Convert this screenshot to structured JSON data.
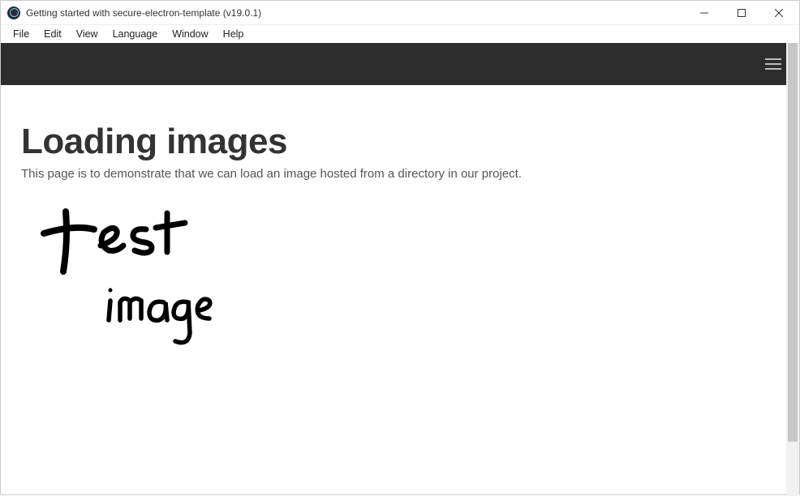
{
  "titlebar": {
    "title": "Getting started with secure-electron-template (v19.0.1)"
  },
  "menubar": {
    "items": [
      "File",
      "Edit",
      "View",
      "Language",
      "Window",
      "Help"
    ]
  },
  "page": {
    "heading": "Loading images",
    "description": "This page is to demonstrate that we can load an image hosted from a directory in our project.",
    "image_alt": "test image"
  }
}
